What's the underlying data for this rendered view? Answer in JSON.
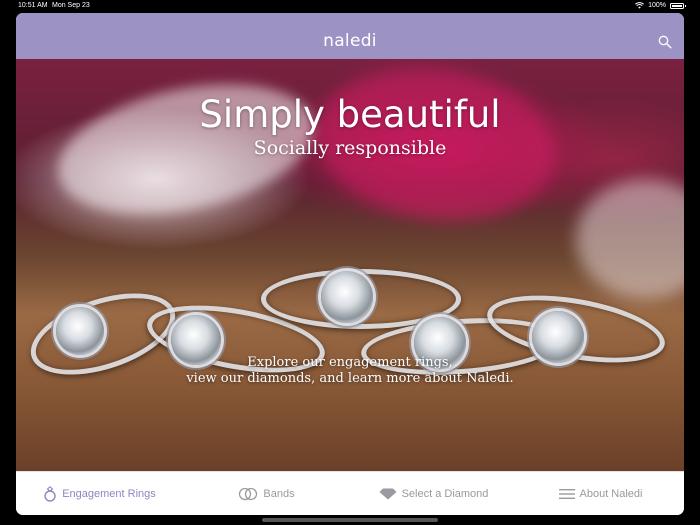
{
  "status_bar": {
    "time": "10:51 AM",
    "date": "Mon Sep 23",
    "battery": "100%",
    "battery_level": 1.0
  },
  "nav": {
    "logo": "naledi",
    "search_icon": "search-icon"
  },
  "hero": {
    "headline": "Simply beautiful",
    "subline": "Socially responsible",
    "explore_line1": "Explore our engagement rings,",
    "explore_line2": "view our diamonds, and learn more about Naledi."
  },
  "tabs": [
    {
      "label": "Engagement Rings",
      "icon": "ring-icon",
      "active": true
    },
    {
      "label": "Bands",
      "icon": "bands-icon",
      "active": false
    },
    {
      "label": "Select a Diamond",
      "icon": "diamond-icon",
      "active": false
    },
    {
      "label": "About Naledi",
      "icon": "menu-icon",
      "active": false
    }
  ],
  "colors": {
    "nav_bg": "#9c93c4",
    "active_tab": "#8f85c0",
    "inactive_tab": "#9a9aa0"
  }
}
